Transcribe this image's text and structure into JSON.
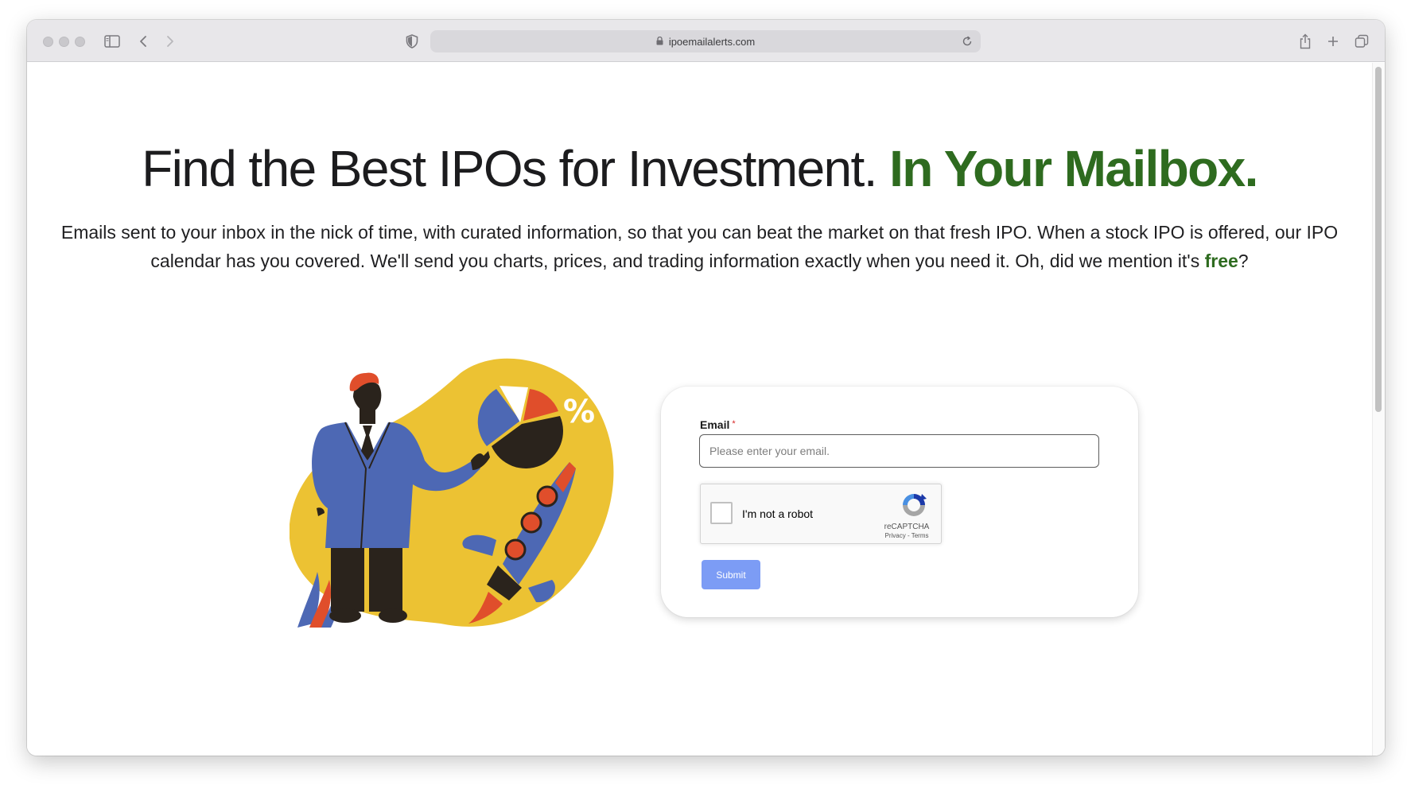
{
  "browser": {
    "url": "ipoemailalerts.com"
  },
  "hero": {
    "title_main": "Find the Best IPOs for Investment.",
    "title_accent": "In Your Mailbox.",
    "description_main": "Emails sent to your inbox in the nick of time, with curated information, so that you can beat the market on that fresh IPO. When a stock IPO is offered, our IPO calendar has you covered. We'll send you charts, prices, and trading information exactly when you need it. Oh, did we mention it's ",
    "description_free": "free",
    "description_end": "?"
  },
  "illustration": {
    "percent_text": "%"
  },
  "form": {
    "email_label": "Email",
    "required_marker": "*",
    "email_placeholder": "Please enter your email.",
    "email_value": "",
    "recaptcha_label": "I'm not a robot",
    "recaptcha_brand": "reCAPTCHA",
    "recaptcha_links": "Privacy - Terms",
    "submit_label": "Submit"
  },
  "colors": {
    "accent_green": "#2e6b1f",
    "submit_blue": "#7c9cf5",
    "illustration_yellow": "#ecc233",
    "suit_blue": "#4d68b4",
    "rocket_red": "#e04e2b"
  }
}
